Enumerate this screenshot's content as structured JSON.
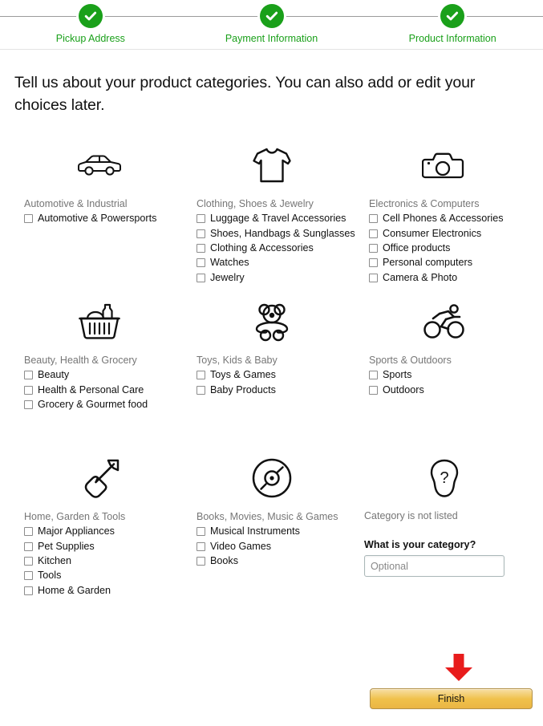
{
  "progress": {
    "steps": [
      {
        "label": "Pickup Address",
        "icon": "check-circle-icon",
        "complete": true
      },
      {
        "label": "Payment Information",
        "icon": "check-circle-icon",
        "complete": true
      },
      {
        "label": "Product Information",
        "icon": "check-circle-icon",
        "complete": true
      }
    ],
    "accent_color": "#1aa01a"
  },
  "heading": "Tell us about your product categories. You can also add or edit your choices later.",
  "categories": [
    {
      "icon": "car-icon",
      "title": "Automotive & Industrial",
      "items": [
        "Automotive & Powersports"
      ]
    },
    {
      "icon": "tshirt-icon",
      "title": "Clothing, Shoes & Jewelry",
      "items": [
        "Luggage & Travel Accessories",
        "Shoes, Handbags & Sunglasses",
        "Clothing & Accessories",
        "Watches",
        "Jewelry"
      ]
    },
    {
      "icon": "camera-icon",
      "title": "Electronics & Computers",
      "items": [
        "Cell Phones & Accessories",
        "Consumer Electronics",
        "Office products",
        "Personal computers",
        "Camera & Photo"
      ]
    },
    {
      "icon": "grocery-basket-icon",
      "title": "Beauty, Health & Grocery",
      "items": [
        "Beauty",
        "Health & Personal Care",
        "Grocery & Gourmet food"
      ]
    },
    {
      "icon": "teddy-bear-icon",
      "title": "Toys, Kids & Baby",
      "items": [
        "Toys & Games",
        "Baby Products"
      ]
    },
    {
      "icon": "cyclist-icon",
      "title": "Sports & Outdoors",
      "items": [
        "Sports",
        "Outdoors"
      ]
    },
    {
      "icon": "shovel-icon",
      "title": "Home, Garden & Tools",
      "items": [
        "Major Appliances",
        "Pet Supplies",
        "Kitchen",
        "Tools",
        "Home & Garden"
      ]
    },
    {
      "icon": "disc-icon",
      "title": "Books, Movies, Music & Games",
      "items": [
        "Musical Instruments",
        "Video Games",
        "Books"
      ]
    }
  ],
  "not_listed": {
    "icon": "question-head-icon",
    "title": "Category is not listed",
    "field_label": "What is your category?",
    "input_value": "",
    "input_placeholder": "Optional"
  },
  "footer": {
    "arrow_icon": "red-down-arrow-icon",
    "arrow_color": "#e81c1c",
    "finish_label": "Finish",
    "finish_color": "#f0c14b"
  }
}
